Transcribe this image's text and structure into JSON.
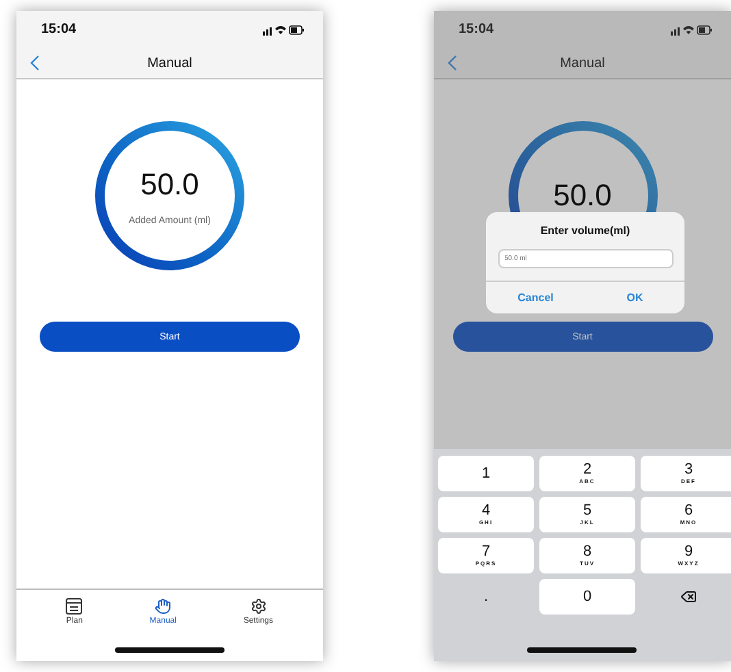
{
  "screens": [
    {
      "status_time": "15:04",
      "title": "Manual",
      "gauge": {
        "value": "50.0",
        "label": "Added Amount (ml)"
      },
      "start_button": "Start",
      "tab_bar": [
        {
          "label": "Plan",
          "kind": "plan",
          "selected": false
        },
        {
          "label": "Manual",
          "kind": "hand",
          "selected": true
        },
        {
          "label": "Settings",
          "kind": "gear",
          "selected": false
        }
      ]
    },
    {
      "status_time": "15:04",
      "title": "Manual",
      "gauge": {
        "value": "50.0"
      },
      "start_button": "Start",
      "dialog": {
        "title": "Enter volume(ml)",
        "placeholder": "50.0 ml",
        "buttons": [
          "Cancel",
          "OK"
        ]
      },
      "keypad": [
        {
          "kind": "digit",
          "digit": "1"
        },
        {
          "kind": "digit",
          "digit": "2",
          "letters": "ABC"
        },
        {
          "kind": "digit",
          "digit": "3",
          "letters": "DEF"
        },
        {
          "kind": "digit",
          "digit": "4",
          "letters": "GHI"
        },
        {
          "kind": "digit",
          "digit": "5",
          "letters": "JKL"
        },
        {
          "kind": "digit",
          "digit": "6",
          "letters": "MNO"
        },
        {
          "kind": "digit",
          "digit": "7",
          "letters": "PQRS"
        },
        {
          "kind": "digit",
          "digit": "8",
          "letters": "TUV"
        },
        {
          "kind": "digit",
          "digit": "9",
          "letters": "WXYZ"
        },
        {
          "kind": "dot",
          "digit": "."
        },
        {
          "kind": "digit",
          "digit": "0"
        },
        {
          "kind": "delete"
        }
      ]
    }
  ]
}
